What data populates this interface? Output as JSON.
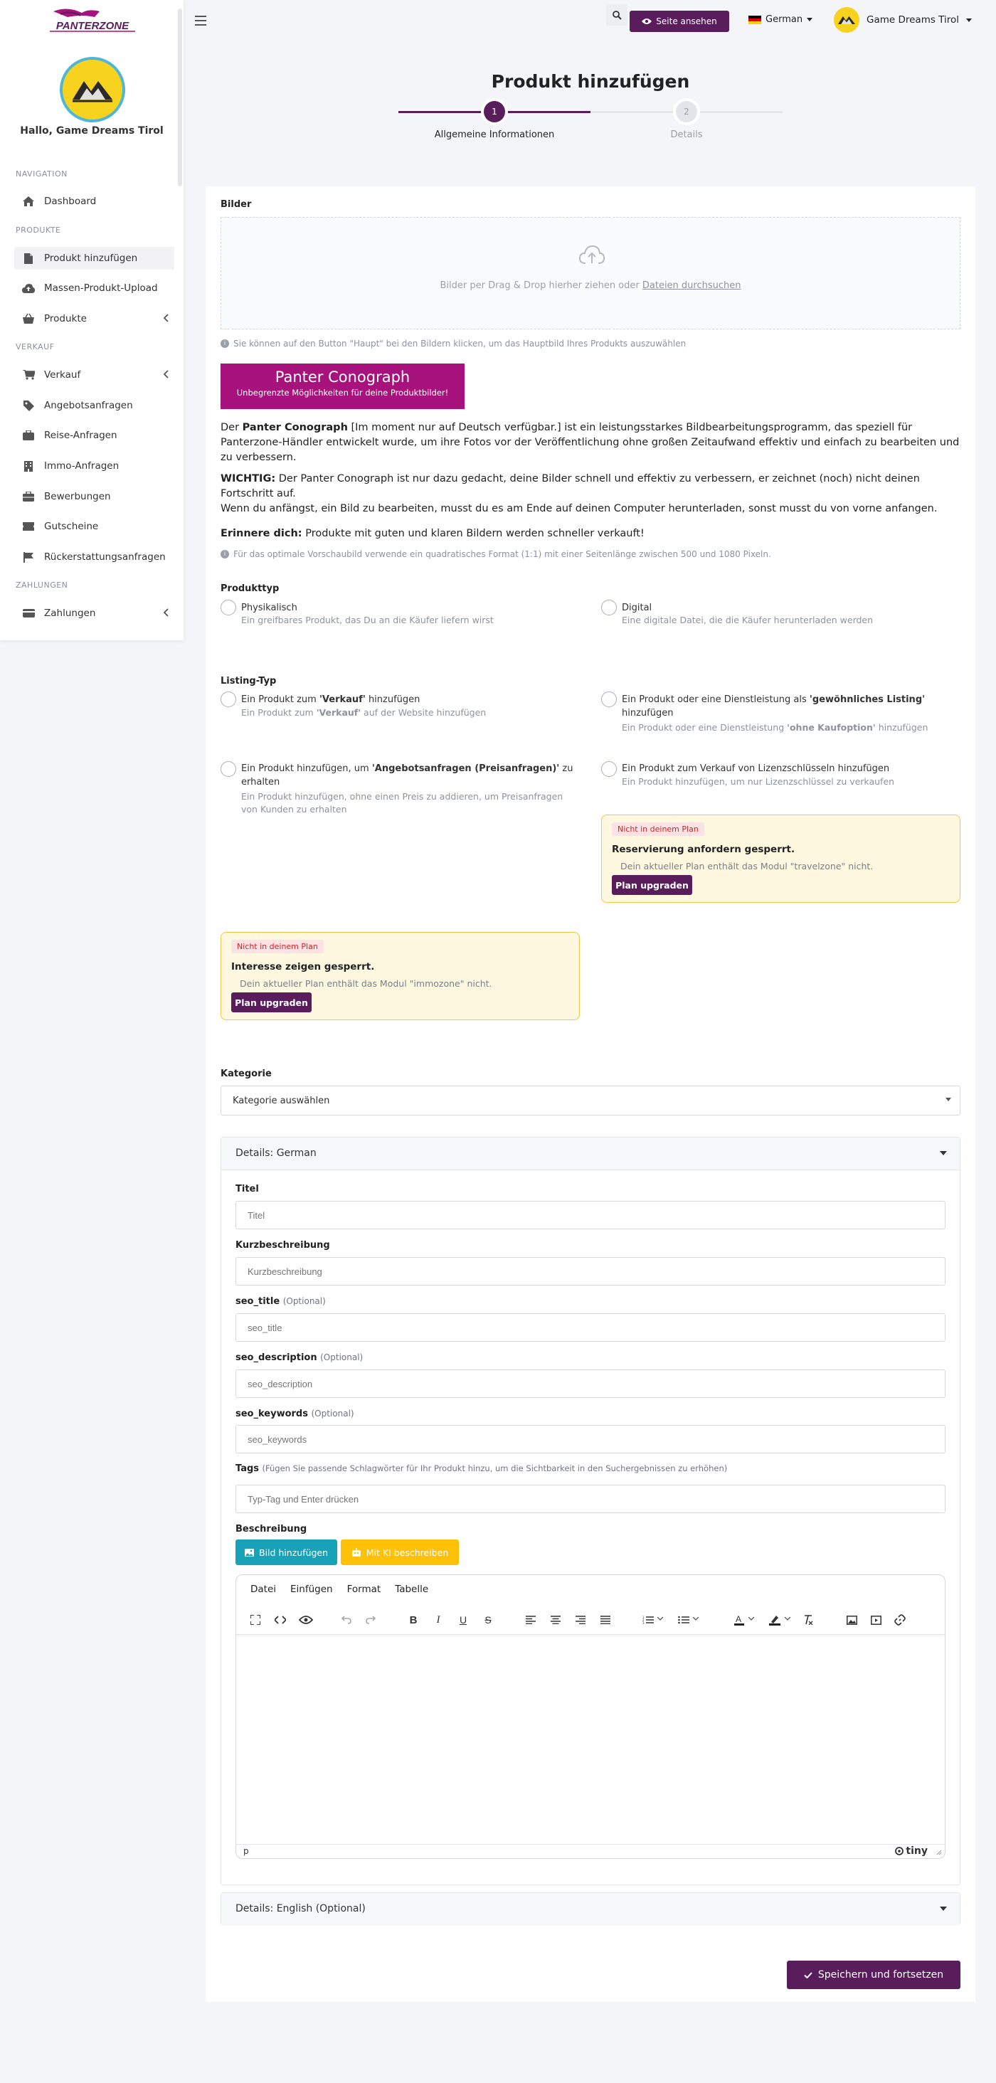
{
  "brand": {
    "logo_text": "PANTERZONE"
  },
  "sidebar": {
    "greeting": "Hallo, Game Dreams Tirol",
    "sections": {
      "navigation": "NAVIGATION",
      "products": "PRODUKTE",
      "sales": "VERKAUF",
      "payments": "ZAHLUNGEN"
    },
    "items": [
      {
        "label": "Dashboard",
        "icon": "home-icon"
      },
      {
        "label": "Produkt hinzufügen",
        "icon": "file-icon"
      },
      {
        "label": "Massen-Produkt-Upload",
        "icon": "cloud-upload-icon"
      },
      {
        "label": "Produkte",
        "icon": "basket-icon"
      },
      {
        "label": "Verkauf",
        "icon": "cart-icon"
      },
      {
        "label": "Angebotsanfragen",
        "icon": "tag-icon"
      },
      {
        "label": "Reise-Anfragen",
        "icon": "suitcase-icon"
      },
      {
        "label": "Immo-Anfragen",
        "icon": "building-icon"
      },
      {
        "label": "Bewerbungen",
        "icon": "briefcase-icon"
      },
      {
        "label": "Gutscheine",
        "icon": "voucher-icon"
      },
      {
        "label": "Rückerstattungsanfragen",
        "icon": "flag-icon"
      },
      {
        "label": "Zahlungen",
        "icon": "wallet-icon"
      }
    ]
  },
  "topbar": {
    "view_site": "Seite ansehen",
    "language": "German",
    "user": "Game Dreams Tirol"
  },
  "stepper": {
    "title": "Produkt hinzufügen",
    "steps": [
      {
        "num": "1",
        "label": "Allgemeine Informationen"
      },
      {
        "num": "2",
        "label": "Details"
      }
    ]
  },
  "images": {
    "label": "Bilder",
    "dropzone_text": "Bilder per Drag & Drop hierher ziehen oder ",
    "dropzone_link": "Dateien durchsuchen",
    "hint": "Sie können auf den Button \"Haupt\" bei den Bildern klicken, um das Hauptbild Ihres Produkts auszuwählen"
  },
  "conograph": {
    "btn_title": "Panter Conograph",
    "btn_sub": "Unbegrenzte Möglichkeiten für deine Produktbilder!",
    "p1_prefix": "Der ",
    "p1_bold": "Panter Conograph",
    "p1_rest": " [Im moment nur auf Deutsch verfügbar.] ist ein leistungsstarkes Bildbearbeitungsprogramm, das speziell für Panterzone-Händler entwickelt wurde, um ihre Fotos vor der Veröffentlichung ohne großen Zeitaufwand effektiv und einfach zu bearbeiten und zu verbessern.",
    "p2_bold": "WICHTIG:",
    "p2_rest": " Der Panter Conograph ist nur dazu gedacht, deine Bilder schnell und effektiv zu verbessern, er zeichnet (noch) nicht deinen Fortschritt auf.",
    "p2_line2": "Wenn du anfängst, ein Bild zu bearbeiten, musst du es am Ende auf deinen Computer herunterladen, sonst musst du von vorne anfangen.",
    "p3_bold": "Erinnere dich:",
    "p3_rest": " Produkte mit guten und klaren Bildern werden schneller verkauft!",
    "hint": "Für das optimale Vorschaubild verwende ein quadratisches Format (1:1) mit einer Seitenlänge zwischen 500 und 1080 Pixeln."
  },
  "product_type": {
    "label": "Produkttyp",
    "options": [
      {
        "title": "Physikalisch",
        "desc": "Ein greifbares Produkt, das Du an die Käufer liefern wirst"
      },
      {
        "title": "Digital",
        "desc": "Eine digitale Datei, die die Käufer herunterladen werden"
      }
    ]
  },
  "listing_type": {
    "label": "Listing-Typ",
    "opt1_title_a": "Ein Produkt zum ",
    "opt1_title_b": "'Verkauf'",
    "opt1_title_c": " hinzufügen",
    "opt1_desc_a": "Ein Produkt zum ",
    "opt1_desc_b": "'Verkauf'",
    "opt1_desc_c": " auf der Website hinzufügen",
    "opt2_title_a": "Ein Produkt oder eine Dienstleistung als ",
    "opt2_title_b": "'gewöhnliches Listing'",
    "opt2_title_c": "hinzufügen",
    "opt2_desc_a": "Ein Produkt oder eine Dienstleistung ",
    "opt2_desc_b": "'ohne Kaufoption'",
    "opt2_desc_c": " hinzufügen",
    "opt3_title_a": "Ein Produkt hinzufügen, um ",
    "opt3_title_b": "'Angebotsanfragen (Preisanfragen)'",
    "opt3_title_c": " zu",
    "opt3_title_d": "erhalten",
    "opt3_desc_1": "Ein Produkt hinzufügen, ohne einen Preis zu addieren, um Preisanfragen",
    "opt3_desc_2": "von Kunden zu erhalten",
    "opt4_title": "Ein Produkt zum Verkauf von Lizenzschlüsseln hinzufügen",
    "opt4_desc": "Ein Produkt hinzufügen, um nur Lizenzschlüssel zu verkaufen"
  },
  "locked": [
    {
      "badge": "Nicht in deinem Plan",
      "title": "Reservierung anfordern gesperrt.",
      "desc": "Dein aktueller Plan enthält das Modul \"travelzone\" nicht.",
      "button": "Plan upgraden"
    },
    {
      "badge": "Nicht in deinem Plan",
      "title": "Interesse zeigen gesperrt.",
      "desc": "Dein aktueller Plan enthält das Modul \"immozone\" nicht.",
      "button": "Plan upgraden"
    }
  ],
  "category": {
    "label": "Kategorie",
    "selected": "Kategorie auswählen"
  },
  "details_de": {
    "header": "Details: German",
    "title_label": "Titel",
    "title_ph": "Titel",
    "short_label": "Kurzbeschreibung",
    "short_ph": "Kurzbeschreibung",
    "seo_title_label": "seo_title",
    "seo_title_ph": "seo_title",
    "seo_desc_label": "seo_description",
    "seo_desc_ph": "seo_description",
    "seo_kw_label": "seo_keywords",
    "seo_kw_ph": "seo_keywords",
    "optional": "(Optional)",
    "tags_label": "Tags",
    "tags_hint": "(Fügen Sie passende Schlagwörter für Ihr Produkt hinzu, um die Sichtbarkeit in den Suchergebnissen zu erhöhen)",
    "tags_ph": "Typ-Tag und Enter drücken",
    "desc_label": "Beschreibung",
    "btn_image": "Bild hinzufügen",
    "btn_ai": "Mit KI beschreiben"
  },
  "editor": {
    "menu": [
      "Datei",
      "Einfügen",
      "Format",
      "Tabelle"
    ],
    "status_path": "p",
    "brand": "tiny"
  },
  "details_en": {
    "header": "Details: English (Optional)"
  },
  "save_button": "Speichern und fortsetzen",
  "colors": {
    "primary": "#5a1d5c",
    "magenta": "#a7127c",
    "info": "#17a2b8",
    "warning": "#ffc107",
    "lock_bg": "#fff8e1"
  }
}
